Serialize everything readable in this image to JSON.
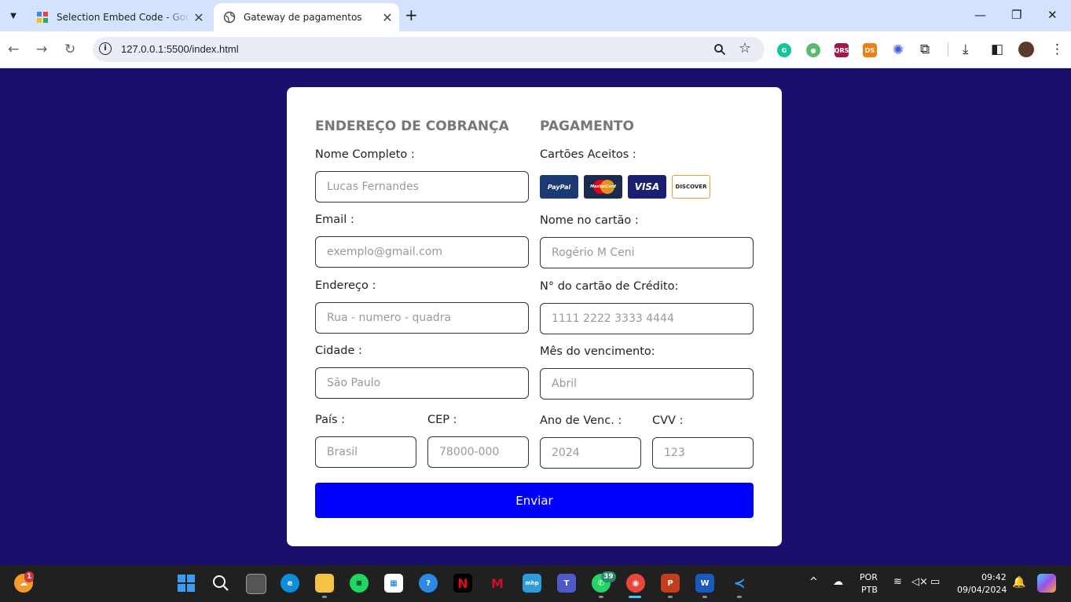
{
  "browser": {
    "tabs": [
      {
        "title": "Selection Embed Code - Google"
      },
      {
        "title": "Gateway de pagamentos"
      }
    ],
    "url": "127.0.0.1:5500/index.html"
  },
  "form": {
    "billing": {
      "heading": "ENDEREÇO DE COBRANÇA",
      "fields": [
        {
          "label": "Nome Completo :",
          "placeholder": "Lucas Fernandes"
        },
        {
          "label": "Email :",
          "placeholder": "exemplo@gmail.com"
        },
        {
          "label": "Endereço :",
          "placeholder": "Rua - numero - quadra"
        },
        {
          "label": "Cidade :",
          "placeholder": "São Paulo"
        },
        {
          "label": "País :",
          "placeholder": "Brasil"
        },
        {
          "label": "CEP :",
          "placeholder": "78000-000"
        }
      ]
    },
    "payment": {
      "heading": "PAGAMENTO",
      "accepted_label": "Cartões Aceitos :",
      "card_brands": [
        "PayPal",
        "MasterCard",
        "VISA",
        "DISCOVER"
      ],
      "fields": [
        {
          "label": "Nome no cartão :",
          "placeholder": "Rogério M Ceni"
        },
        {
          "label": "N° do cartão de Crédito:",
          "placeholder": "1111 2222 3333 4444"
        },
        {
          "label": "Mês do vencimento:",
          "placeholder": "Abril"
        },
        {
          "label": "Ano de Venc. :",
          "placeholder": "2024"
        },
        {
          "label": "CVV :",
          "placeholder": "123"
        }
      ]
    },
    "submit_label": "Enviar"
  },
  "taskbar": {
    "weather_badge": "1",
    "whatsapp_badge": "39",
    "language": "POR",
    "layout": "PTB",
    "time": "09:42",
    "date": "09/04/2024"
  },
  "colors": {
    "page_background": "#1b0f6e",
    "submit_button": "#0000ff"
  }
}
